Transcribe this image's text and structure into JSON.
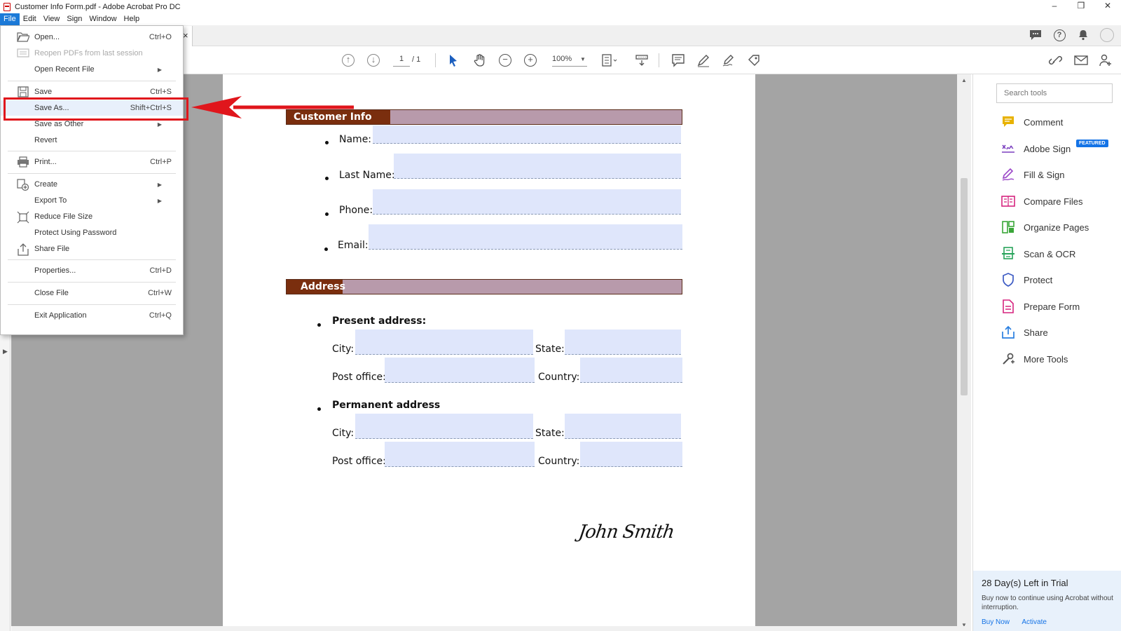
{
  "window": {
    "title": "Customer Info Form.pdf - Adobe Acrobat Pro DC",
    "controls": [
      "–",
      "❒",
      "✕"
    ]
  },
  "menubar": [
    "File",
    "Edit",
    "View",
    "Sign",
    "Window",
    "Help"
  ],
  "tab": {
    "close": "×"
  },
  "toolbar": {
    "page_current": "1",
    "page_total": "/ 1",
    "zoom": "100%"
  },
  "file_menu": {
    "items": [
      {
        "label": "Open...",
        "shortcut": "Ctrl+O",
        "icon": "folder-open-icon"
      },
      {
        "label": "Reopen PDFs from last session",
        "shortcut": "",
        "icon": "reopen-icon",
        "disabled": true
      },
      {
        "label": "Open Recent File",
        "shortcut": "",
        "submenu": true
      },
      {
        "label": "Save",
        "shortcut": "Ctrl+S",
        "icon": "save-icon"
      },
      {
        "label": "Save As...",
        "shortcut": "Shift+Ctrl+S",
        "highlighted": true
      },
      {
        "label": "Save as Other",
        "shortcut": "",
        "submenu": true
      },
      {
        "label": "Revert",
        "shortcut": ""
      },
      {
        "label": "Print...",
        "shortcut": "Ctrl+P",
        "icon": "print-icon"
      },
      {
        "label": "Create",
        "shortcut": "",
        "submenu": true,
        "icon": "create-icon"
      },
      {
        "label": "Export To",
        "shortcut": "",
        "submenu": true
      },
      {
        "label": "Reduce File Size",
        "shortcut": "",
        "icon": "reduce-size-icon"
      },
      {
        "label": "Protect Using Password",
        "shortcut": ""
      },
      {
        "label": "Share File",
        "shortcut": "",
        "icon": "share-icon"
      },
      {
        "label": "Properties...",
        "shortcut": "Ctrl+D"
      },
      {
        "label": "Close File",
        "shortcut": "Ctrl+W"
      },
      {
        "label": "Exit Application",
        "shortcut": "Ctrl+Q"
      }
    ]
  },
  "document": {
    "header1": "Customer Info Form",
    "fields": [
      "Name:",
      "Last Name:",
      "Phone:",
      "Email:"
    ],
    "header2": "Address",
    "present_address": "Present address:",
    "permanent_address": "Permanent address",
    "city": "City:",
    "state": "State:",
    "post_office": "Post office:",
    "country": "Country:",
    "signature": "John Smith"
  },
  "right_panel": {
    "search_placeholder": "Search tools",
    "featured": "FEATURED",
    "tools": [
      {
        "label": "Comment",
        "color": "#e8b200"
      },
      {
        "label": "Adobe Sign",
        "color": "#7b3fbf"
      },
      {
        "label": "Fill & Sign",
        "color": "#9b46c8"
      },
      {
        "label": "Compare Files",
        "color": "#d6247f"
      },
      {
        "label": "Organize Pages",
        "color": "#3aa639"
      },
      {
        "label": "Scan & OCR",
        "color": "#27a35a"
      },
      {
        "label": "Protect",
        "color": "#3d5bc4"
      },
      {
        "label": "Prepare Form",
        "color": "#d6247f"
      },
      {
        "label": "Share",
        "color": "#2a7fe0"
      },
      {
        "label": "More Tools",
        "color": "#555555"
      }
    ],
    "trial": {
      "title": "28 Day(s) Left in Trial",
      "body": "Buy now to continue using Acrobat without interruption.",
      "buy": "Buy Now",
      "activate": "Activate"
    }
  },
  "colors": {
    "menu_active": "#1c7ad8",
    "highlight": "#e0161c",
    "section_header": "#7a2e0e",
    "field_fill": "#dfe6fb"
  }
}
